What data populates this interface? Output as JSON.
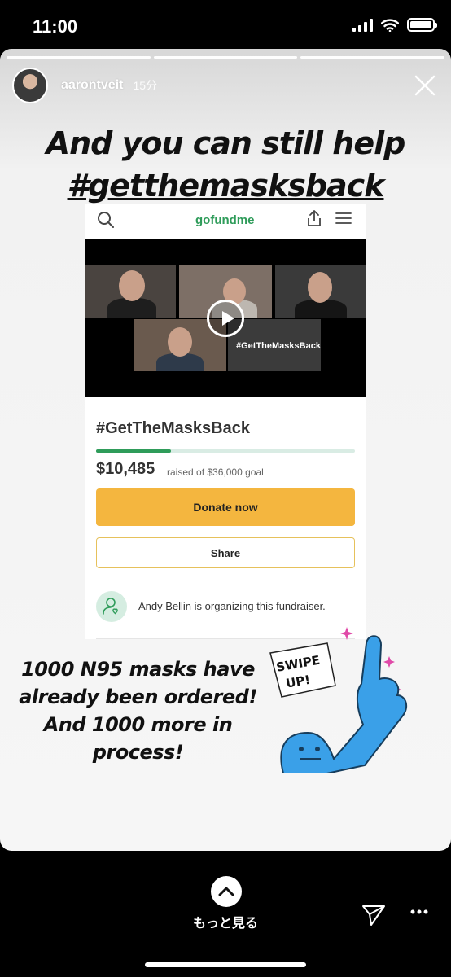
{
  "status_bar": {
    "time": "11:00"
  },
  "story": {
    "username": "aarontveit",
    "timestamp": "15分",
    "headline_line1": "And you can still help",
    "headline_hashtag": "#getthemasksback",
    "body_text": "1000 N95 masks have already been ordered! And 1000 more in process!",
    "sticker_text": "SWIPE UP!"
  },
  "gofundme": {
    "logo": "gofundme",
    "video_label": "#GetTheMasksBack",
    "campaign_title": "#GetTheMasksBack",
    "raised_amount": "$10,485",
    "goal_text": "raised of $36,000 goal",
    "progress_fraction": 0.29,
    "donate_label": "Donate now",
    "share_label": "Share",
    "organizer_text": "Andy Bellin is organizing this fundraiser."
  },
  "footer": {
    "see_more_label": "もっと見る"
  },
  "icons": [
    "close-icon",
    "search-icon",
    "share-upload-icon",
    "menu-icon",
    "play-icon",
    "organizer-icon",
    "chevron-up-icon",
    "send-icon",
    "more-icon"
  ],
  "colors": {
    "donate": "#f4b63f",
    "brand_green": "#2f9c5a",
    "sticker_blue": "#3aa0e8"
  }
}
